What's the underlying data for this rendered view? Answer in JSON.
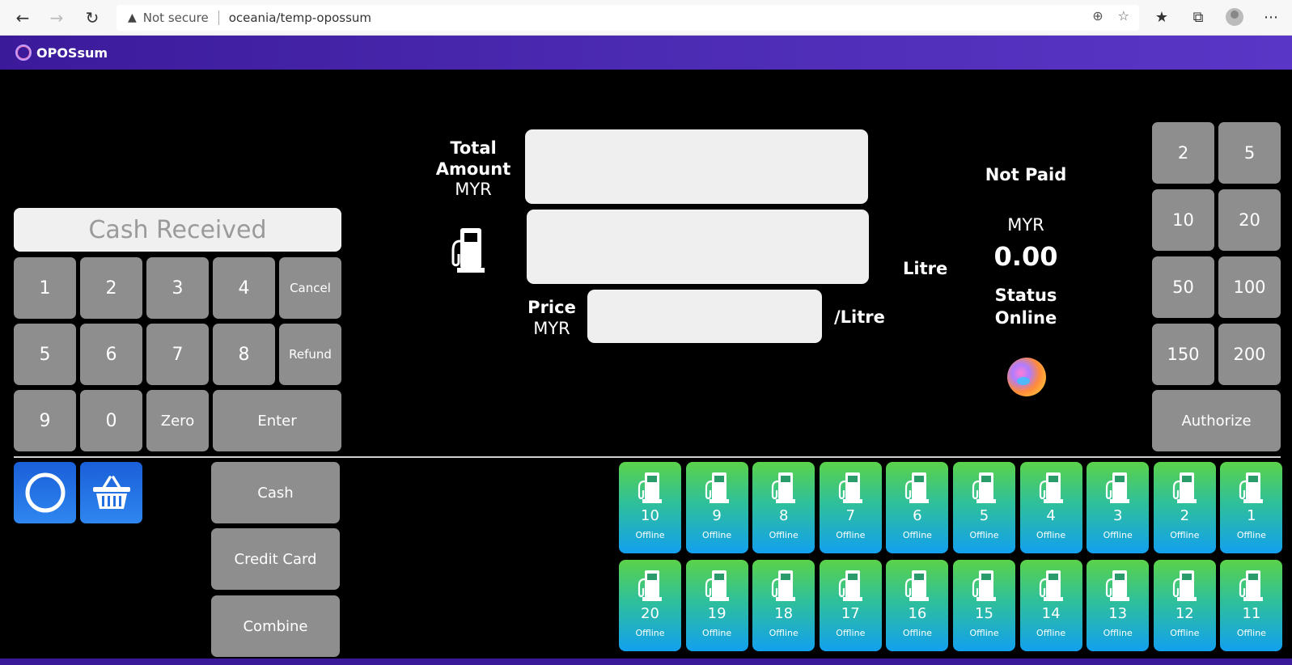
{
  "browser": {
    "security_label": "Not secure",
    "url": "oceania/temp-opossum"
  },
  "app": {
    "title": "OPOSsum"
  },
  "cash": {
    "placeholder": "Cash Received"
  },
  "keypad": {
    "k1": "1",
    "k2": "2",
    "k3": "3",
    "k4": "4",
    "cancel": "Cancel",
    "k5": "5",
    "k6": "6",
    "k7": "7",
    "k8": "8",
    "refund": "Refund",
    "k9": "9",
    "k0": "0",
    "zero": "Zero",
    "enter": "Enter"
  },
  "payment": {
    "cash": "Cash",
    "credit_card": "Credit Card",
    "combine": "Combine"
  },
  "transaction": {
    "total_label_1": "Total",
    "total_label_2": "Amount",
    "total_currency": "MYR",
    "volume_unit": "Litre",
    "price_label": "Price",
    "price_currency": "MYR",
    "price_unit": "/Litre"
  },
  "status": {
    "paid_state": "Not Paid",
    "currency": "MYR",
    "amount": "0.00",
    "status_label": "Status",
    "status_value": "Online"
  },
  "presets": {
    "p2": "2",
    "p5": "5",
    "p10": "10",
    "p20": "20",
    "p50": "50",
    "p100": "100",
    "p150": "150",
    "p200": "200",
    "authorize": "Authorize"
  },
  "pumps": {
    "p10": {
      "num": "10",
      "status": "Offline"
    },
    "p9": {
      "num": "9",
      "status": "Offline"
    },
    "p8": {
      "num": "8",
      "status": "Offline"
    },
    "p7": {
      "num": "7",
      "status": "Offline"
    },
    "p6": {
      "num": "6",
      "status": "Offline"
    },
    "p5": {
      "num": "5",
      "status": "Offline"
    },
    "p4": {
      "num": "4",
      "status": "Offline"
    },
    "p3": {
      "num": "3",
      "status": "Offline"
    },
    "p2": {
      "num": "2",
      "status": "Offline"
    },
    "p1": {
      "num": "1",
      "status": "Offline"
    },
    "p20": {
      "num": "20",
      "status": "Offline"
    },
    "p19": {
      "num": "19",
      "status": "Offline"
    },
    "p18": {
      "num": "18",
      "status": "Offline"
    },
    "p17": {
      "num": "17",
      "status": "Offline"
    },
    "p16": {
      "num": "16",
      "status": "Offline"
    },
    "p15": {
      "num": "15",
      "status": "Offline"
    },
    "p14": {
      "num": "14",
      "status": "Offline"
    },
    "p13": {
      "num": "13",
      "status": "Offline"
    },
    "p12": {
      "num": "12",
      "status": "Offline"
    },
    "p11": {
      "num": "11",
      "status": "Offline"
    }
  },
  "colors": {
    "header": "#4c2bb3",
    "key": "#8e8e8e",
    "pump_top": "#5bd24a",
    "pump_bottom": "#12a0ee",
    "action_blue": "#1a5fd8"
  }
}
